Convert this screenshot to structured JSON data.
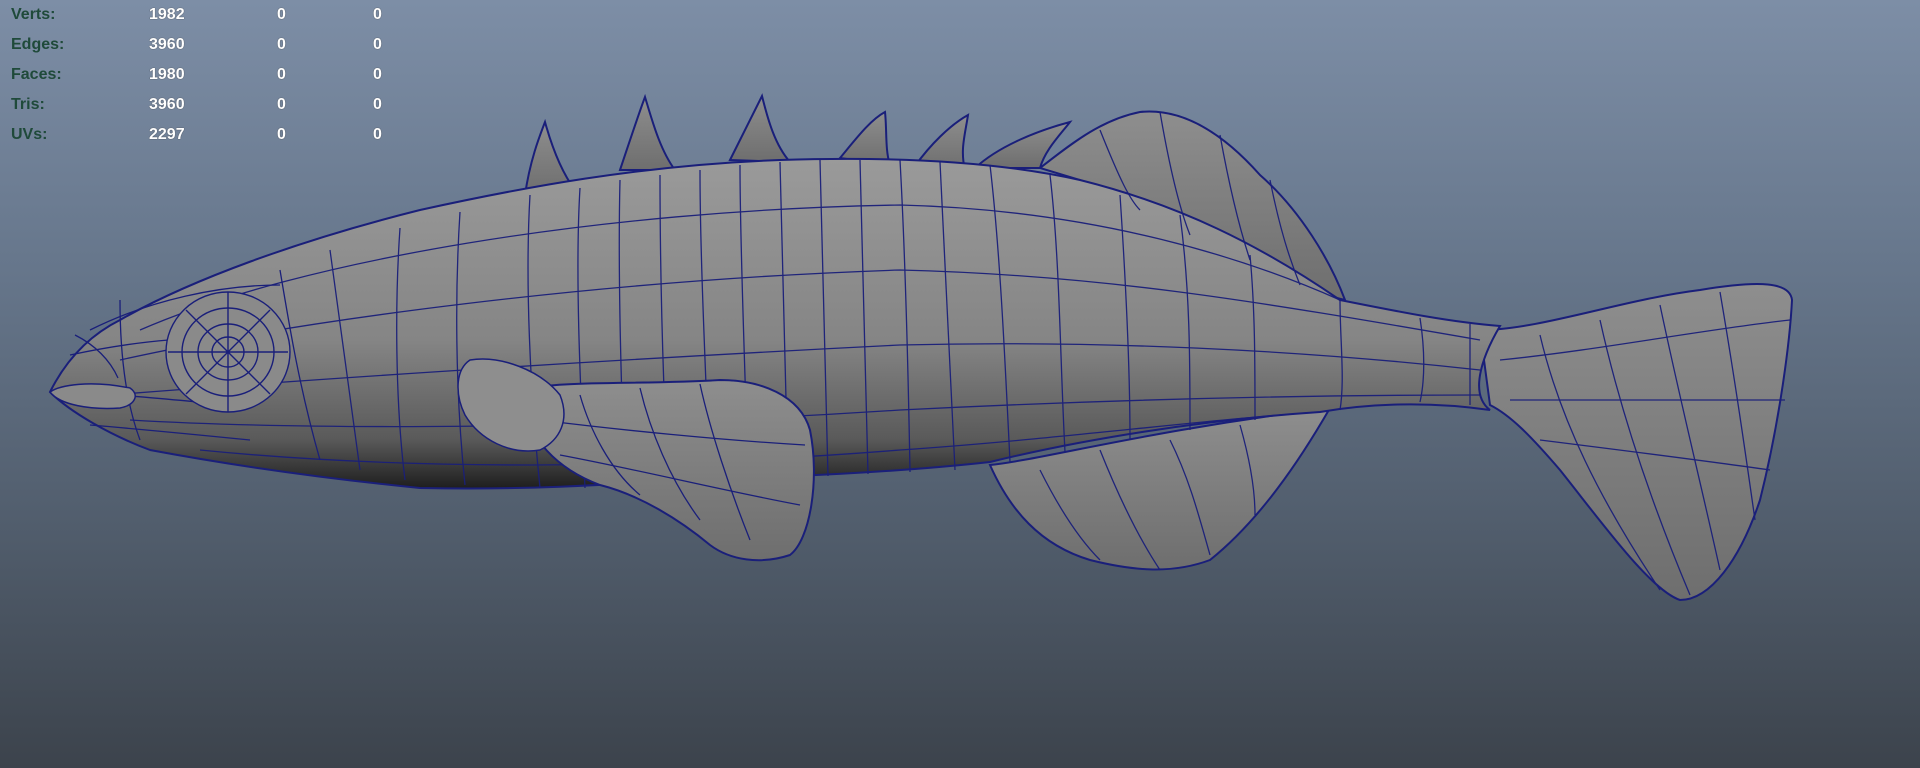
{
  "hud": {
    "rows": [
      {
        "label": "Verts:",
        "total": "1982",
        "selected": "0",
        "other": "0"
      },
      {
        "label": "Edges:",
        "total": "3960",
        "selected": "0",
        "other": "0"
      },
      {
        "label": "Faces:",
        "total": "1980",
        "selected": "0",
        "other": "0"
      },
      {
        "label": "Tris:",
        "total": "3960",
        "selected": "0",
        "other": "0"
      },
      {
        "label": "UVs:",
        "total": "2297",
        "selected": "0",
        "other": "0"
      }
    ],
    "label_color": "#1f4a3a",
    "value_color": "#ffffff"
  },
  "viewport": {
    "background_top": "#7d8ea6",
    "background_bottom": "#3c434c",
    "mesh_fill": "#8a8a8a",
    "wire_color": "#1a1f7a",
    "model_icon": "fish-mesh-icon"
  }
}
